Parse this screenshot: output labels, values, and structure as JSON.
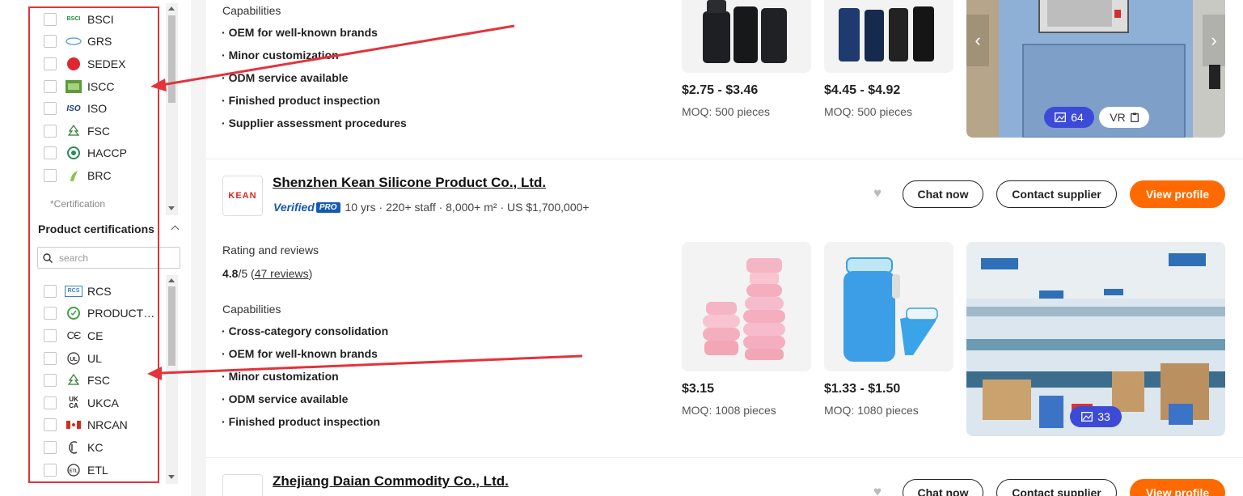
{
  "sidebar": {
    "management_certs": [
      {
        "name": "BSCI",
        "icon": "bsci-logo-icon"
      },
      {
        "name": "GRS",
        "icon": "grs-logo-icon"
      },
      {
        "name": "SEDEX",
        "icon": "sedex-logo-icon"
      },
      {
        "name": "ISCC",
        "icon": "iscc-logo-icon"
      },
      {
        "name": "ISO",
        "icon": "iso-logo-icon"
      },
      {
        "name": "FSC",
        "icon": "fsc-tree-icon"
      },
      {
        "name": "HACCP",
        "icon": "haccp-logo-icon"
      },
      {
        "name": "BRC",
        "icon": "brc-logo-icon"
      }
    ],
    "cert_note": "*Certification",
    "product_cert_title": "Product certifications",
    "search_placeholder": "search",
    "product_certs": [
      {
        "name": "RCS",
        "icon": "rcs-logo-icon"
      },
      {
        "name": "PRODUCT…",
        "icon": "product-cert-logo-icon"
      },
      {
        "name": "CE",
        "icon": "ce-mark-icon"
      },
      {
        "name": "UL",
        "icon": "ul-logo-icon"
      },
      {
        "name": "FSC",
        "icon": "fsc-tree-icon"
      },
      {
        "name": "UKCA",
        "icon": "ukca-mark-icon"
      },
      {
        "name": "NRCAN",
        "icon": "canada-flag-icon"
      },
      {
        "name": "KC",
        "icon": "kc-mark-icon"
      },
      {
        "name": "ETL",
        "icon": "etl-logo-icon"
      }
    ]
  },
  "card1": {
    "capabilities_label": "Capabilities",
    "capabilities": [
      "OEM for well-known brands",
      "Minor customization",
      "ODM service available",
      "Finished product inspection",
      "Supplier assessment procedures"
    ],
    "products": [
      {
        "price": "$2.75 - $3.46",
        "moq": "MOQ: 500 pieces"
      },
      {
        "price": "$4.45 - $4.92",
        "moq": "MOQ: 500 pieces"
      }
    ],
    "photo_count": "64",
    "vr_label": "VR"
  },
  "card2": {
    "logo_text": "KEAN",
    "company_name": "Shenzhen Kean Silicone Product Co., Ltd.",
    "verified_word": "Verified",
    "pro_badge": "PRO",
    "stats": "10 yrs · 220+ staff · 8,000+ m² · US $1,700,000+",
    "chat_label": "Chat now",
    "contact_label": "Contact supplier",
    "view_profile_label": "View profile",
    "rating_label": "Rating and reviews",
    "rating_score": "4.8",
    "rating_max": "/5",
    "reviews": "47 reviews",
    "capabilities_label": "Capabilities",
    "capabilities": [
      "Cross-category consolidation",
      "OEM for well-known brands",
      "Minor customization",
      "ODM service available",
      "Finished product inspection"
    ],
    "products": [
      {
        "price": "$3.15",
        "moq": "MOQ: 1008 pieces"
      },
      {
        "price": "$1.33 - $1.50",
        "moq": "MOQ: 1080 pieces"
      }
    ],
    "photo_count": "33"
  },
  "card3": {
    "company_name": "Zhejiang Daian Commodity Co., Ltd.",
    "chat_label": "Chat now",
    "contact_label": "Contact supplier",
    "view_profile_label": "View profile"
  },
  "colors": {
    "accent": "#ff6a00",
    "annotation": "#e3333b",
    "verified": "#1659b7",
    "photo_badge": "#3b4bd8"
  }
}
